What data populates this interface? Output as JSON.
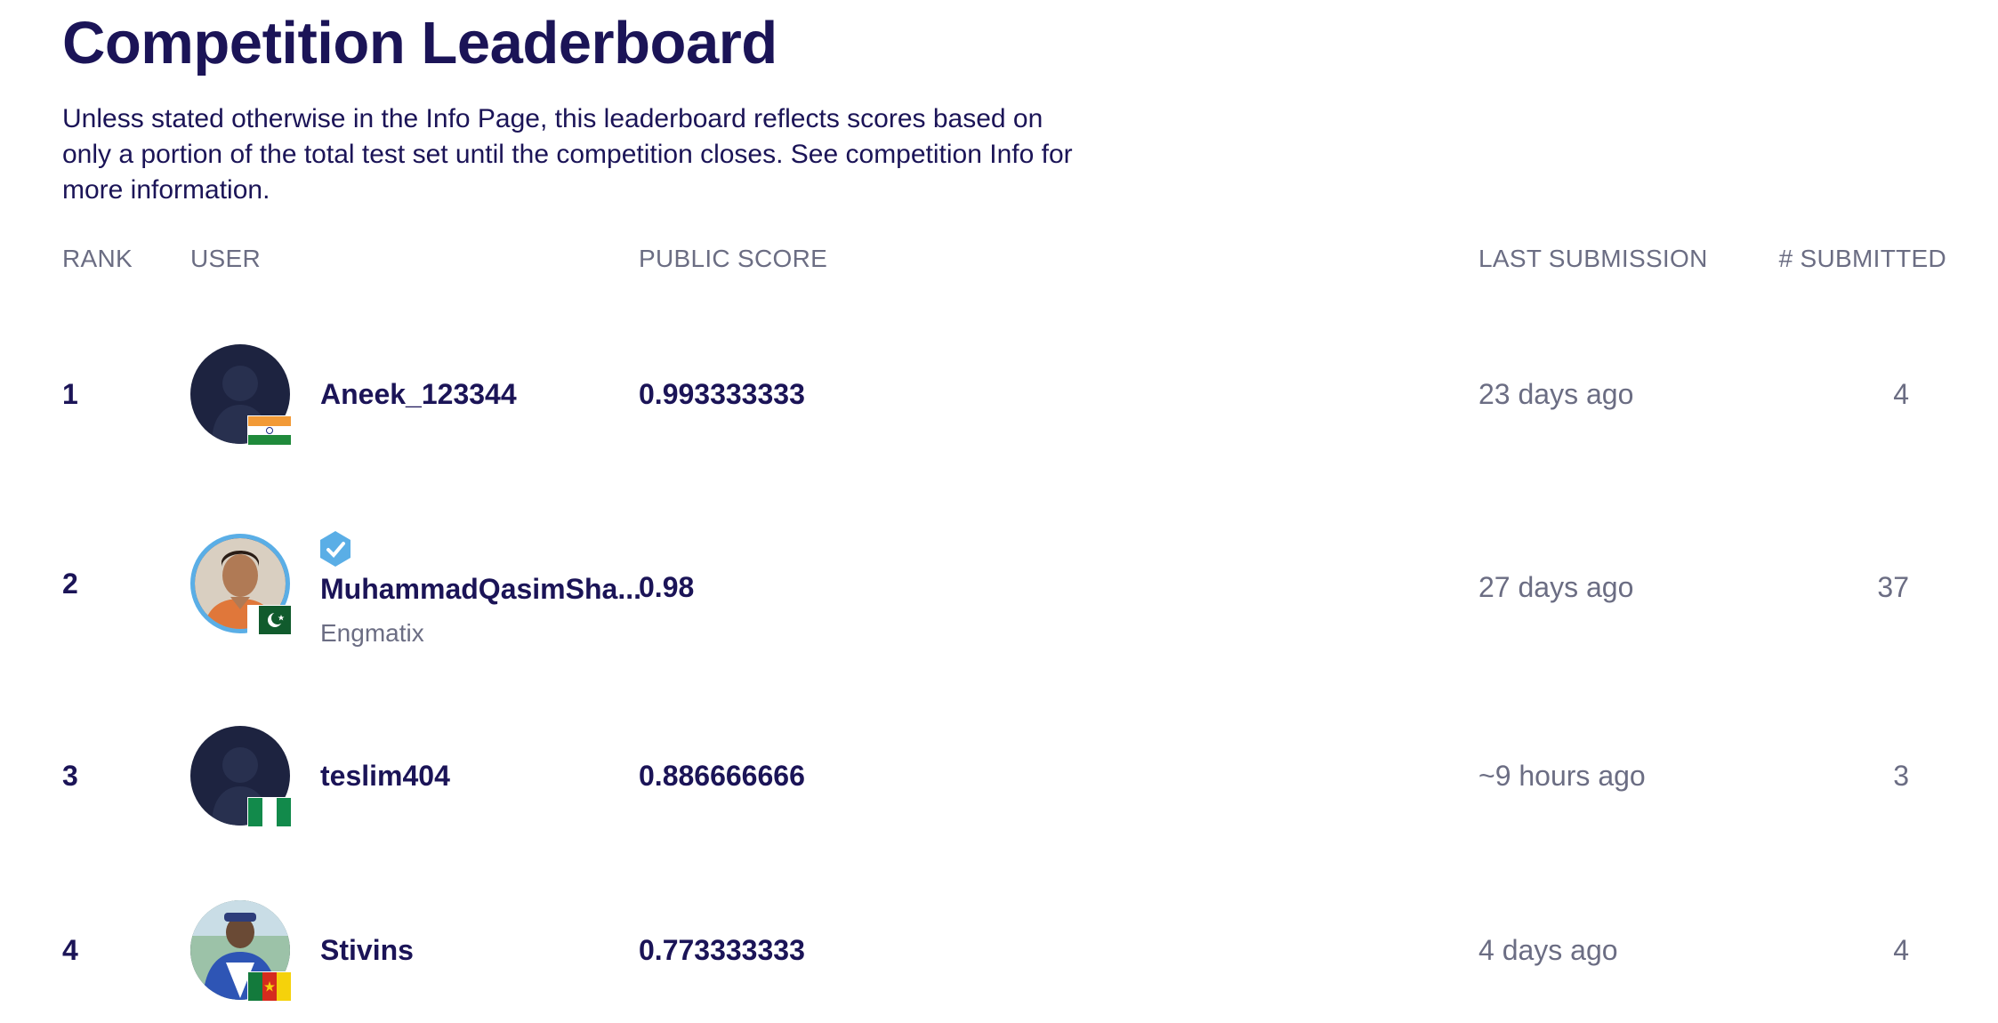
{
  "page": {
    "title": "Competition Leaderboard",
    "intro": "Unless stated otherwise in the Info Page, this leaderboard reflects scores based on only a portion of the total test set until the competition closes. See competition Info for more information."
  },
  "columns": {
    "rank": "RANK",
    "user": "USER",
    "score": "PUBLIC SCORE",
    "last": "LAST SUBMISSION",
    "submitted": "# SUBMITTED"
  },
  "rows": [
    {
      "rank": "1",
      "name": "Aneek_123344",
      "team": "",
      "score": "0.993333333",
      "last": "23 days ago",
      "submitted": "4",
      "flag": "india",
      "avatar": "default-silhouette"
    },
    {
      "rank": "2",
      "name": "MuhammadQasimSha...",
      "team": "Engmatix",
      "score": "0.98",
      "last": "27 days ago",
      "submitted": "37",
      "flag": "pakistan",
      "avatar": "photo",
      "badge": "verified-badge-icon"
    },
    {
      "rank": "3",
      "name": "teslim404",
      "team": "",
      "score": "0.886666666",
      "last": "~9 hours ago",
      "submitted": "3",
      "flag": "nigeria",
      "avatar": "default-silhouette"
    },
    {
      "rank": "4",
      "name": "Stivins",
      "team": "",
      "score": "0.773333333",
      "last": "4 days ago",
      "submitted": "4",
      "flag": "cameroon",
      "avatar": "photo"
    }
  ],
  "colors": {
    "heading": "#1b1457",
    "muted": "#6b6d83",
    "avatar_bg": "#1d2340",
    "badge": "#5aaee6"
  }
}
